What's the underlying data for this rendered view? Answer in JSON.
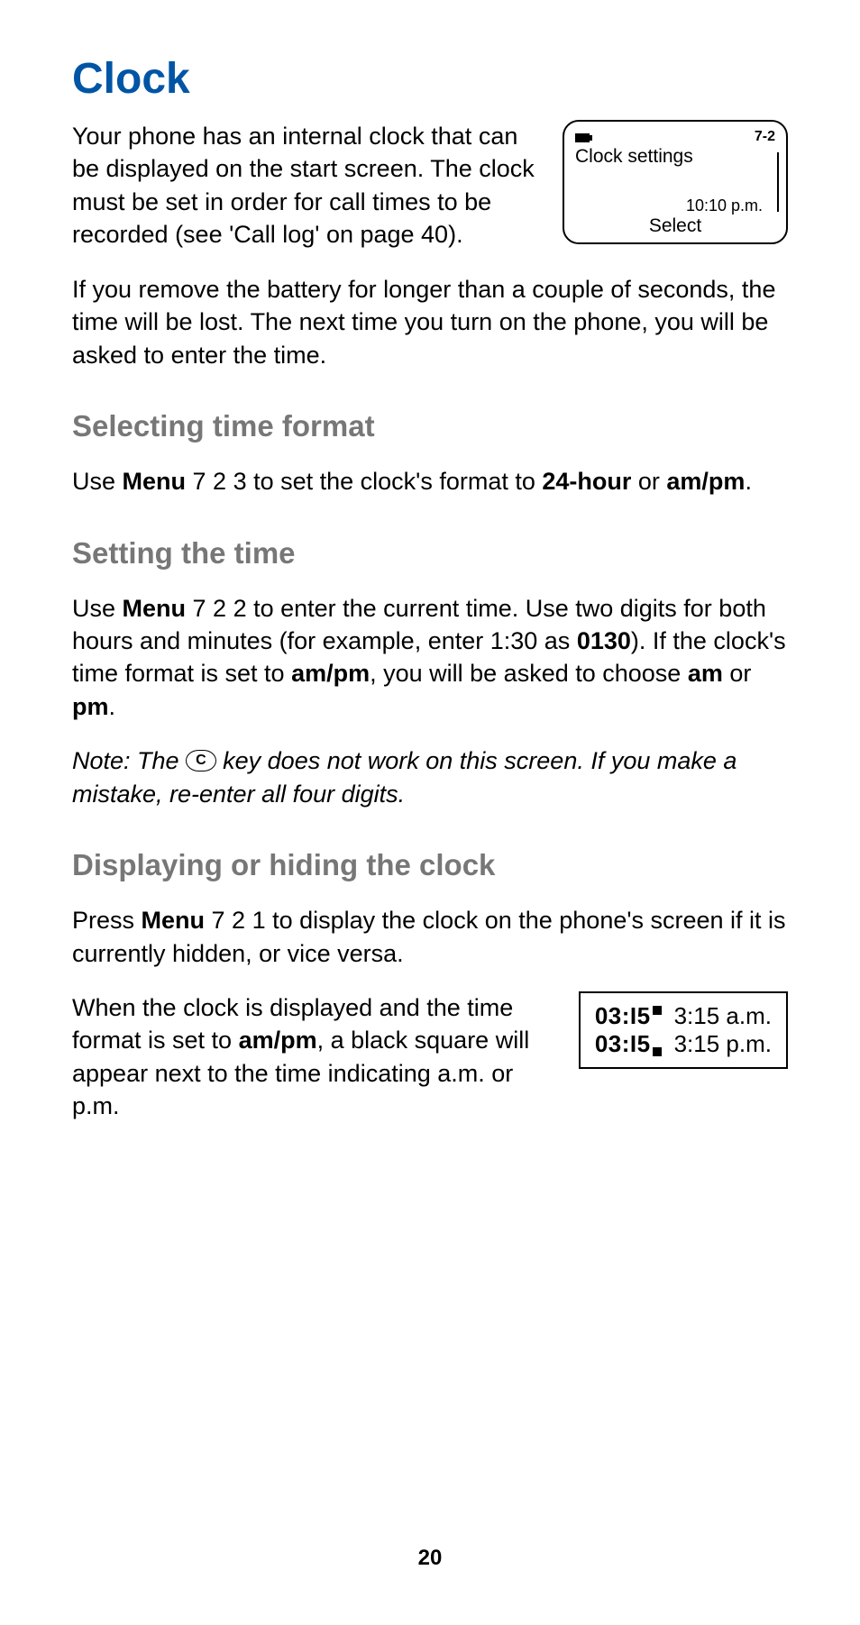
{
  "title": "Clock",
  "intro": {
    "p1_a": "Your phone has an internal clock that can be displayed on the start screen. The clock must be set in order for call times to be recorded (see 'Call log' on page 40).",
    "p2": "If you remove the battery for longer than a couple of seconds, the time will be lost. The next time you turn on the phone, you will be asked to enter the time."
  },
  "screen": {
    "menu_num": "7-2",
    "title": "Clock settings",
    "time": "10:10 p.m.",
    "select": "Select"
  },
  "sec1": {
    "heading": "Selecting time format",
    "p_a": "Use ",
    "p_menu": "Menu",
    "p_b": " 7 2 3 to set the clock's format to ",
    "p_24": "24-hour",
    "p_c": " or ",
    "p_ampm": "am/pm",
    "p_d": "."
  },
  "sec2": {
    "heading": "Setting the time",
    "p_a": "Use ",
    "p_menu": "Menu",
    "p_b": " 7 2 2 to enter the current time. Use two digits for both hours and minutes (for example, enter 1:30 as ",
    "p_0130": "0130",
    "p_c": "). If the clock's time format is set to ",
    "p_ampm": "am/pm",
    "p_d": ", you will be asked to choose ",
    "p_am": "am",
    "p_e": " or ",
    "p_pm": "pm",
    "p_f": ".",
    "note_a": "Note:  The ",
    "note_key": "C",
    "note_b": " key does not work on this screen. If you make a mistake, re-enter all four digits."
  },
  "sec3": {
    "heading": "Displaying or hiding the clock",
    "p1_a": "Press ",
    "p1_menu": "Menu",
    "p1_b": " 7 2 1 to display the clock on the phone's screen if it is currently hidden, or vice versa.",
    "p2_a": "When the clock is displayed and the time format is set to ",
    "p2_ampm": "am/pm",
    "p2_b": ", a black square will appear next to the time indicating a.m. or p.m."
  },
  "ampm_box": {
    "row1_digits": "03:I5",
    "row1_label": "3:15 a.m.",
    "row2_digits": "03:I5",
    "row2_label": "3:15 p.m."
  },
  "page_number": "20"
}
